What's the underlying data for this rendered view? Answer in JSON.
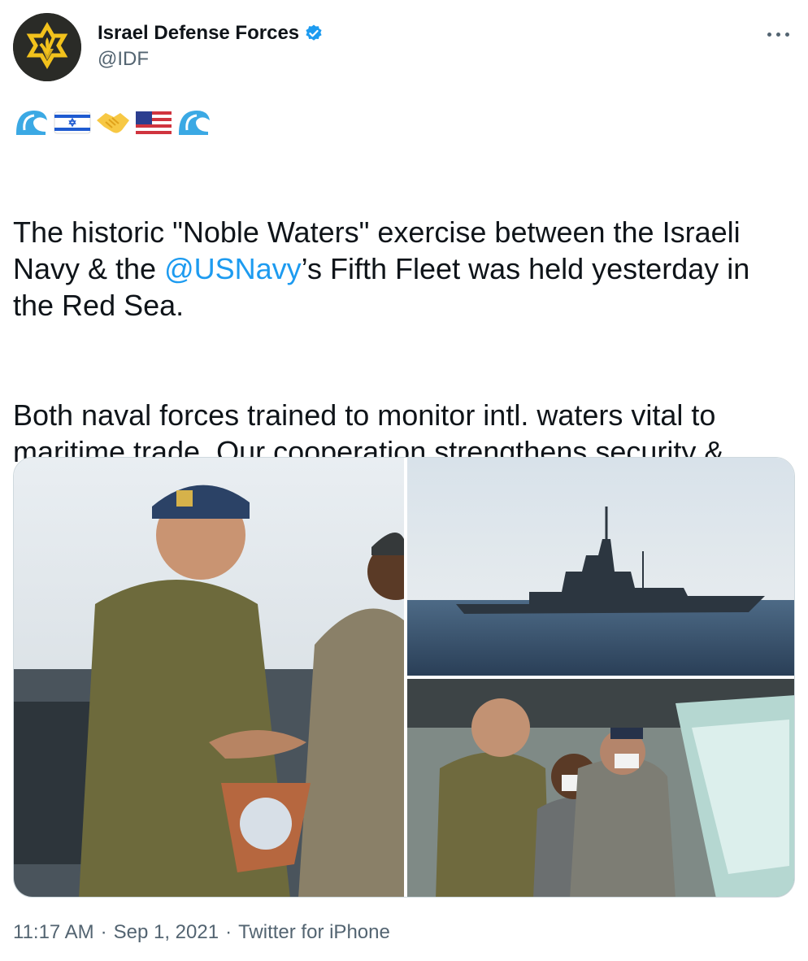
{
  "author": {
    "display_name": "Israel Defense Forces",
    "handle": "@IDF",
    "verified": true,
    "avatar_icon": "idf-emblem-icon",
    "verified_icon": "verified-badge-icon"
  },
  "more_icon": "more-options-icon",
  "emoji_line": [
    "wave-emoji",
    "israel-flag-emoji",
    "handshake-emoji",
    "us-flag-emoji",
    "wave-emoji"
  ],
  "tweet": {
    "para1_pre": "The historic \"Noble Waters\" exercise between the Israeli Navy & the ",
    "mention": "@USNavy",
    "para1_post": "’s Fifth Fleet was held yesterday in the Red Sea.",
    "para2": "Both naval forces trained to monitor intl. waters vital to maritime trade. Our cooperation strengthens security & stability in the region."
  },
  "media": [
    {
      "name": "photo-officers-handshake"
    },
    {
      "name": "photo-warship-at-sea"
    },
    {
      "name": "photo-ship-bridge-crew"
    }
  ],
  "meta": {
    "time": "11:17 AM",
    "date": "Sep 1, 2021",
    "source": "Twitter for iPhone",
    "separator": "·"
  },
  "colors": {
    "link": "#1d9bf0",
    "secondary_text": "#536471",
    "verified": "#1d9bf0"
  }
}
